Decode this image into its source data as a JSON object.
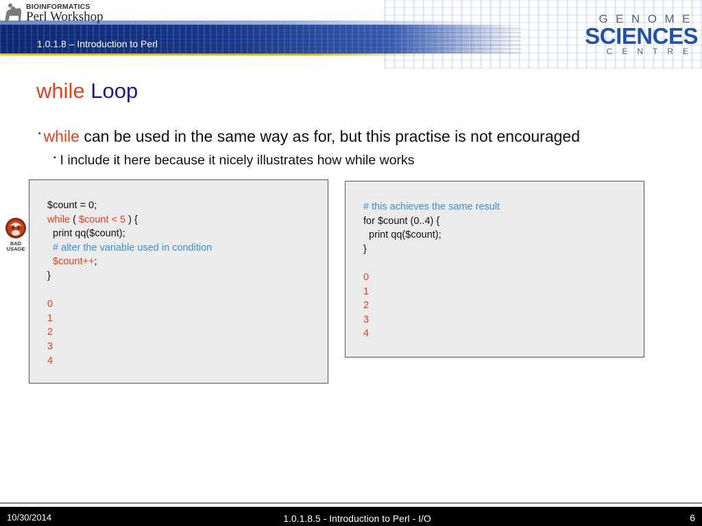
{
  "header": {
    "logo_small": "BIOINFORMATICS",
    "logo_big": "Perl Workshop",
    "course_label": "1.0.1.8 – Introduction to Perl",
    "gsc_top": "GENOME",
    "gsc_mid": "SCIENCES",
    "gsc_bottom": "CENTRE"
  },
  "slide": {
    "title_keyword": "while",
    "title_rest": "Loop",
    "bullet1_keyword": "while",
    "bullet1_rest": "can be used in the same way as for, but this practise is not encouraged",
    "bullet2": "I include it here because it nicely illustrates how while works"
  },
  "badge": {
    "line1": "BAD",
    "line2": "USAGE"
  },
  "code_left": {
    "l1": "$count = 0;",
    "l2_kw": "while",
    "l2_a": " ( ",
    "l2_cond": "$count < 5",
    "l2_b": " ) {",
    "l3": "  print qq($count);",
    "l4": "  # alter the variable used in condition",
    "l5_var": "  $count++",
    "l5_end": ";",
    "l6": "}",
    "out": [
      "0",
      "1",
      "2",
      "3",
      "4"
    ]
  },
  "code_right": {
    "l1": "# this achieves the same result",
    "l2": "for $count (0..4) {",
    "l3": "  print qq($count);",
    "l4": "}",
    "out": [
      "0",
      "1",
      "2",
      "3",
      "4"
    ]
  },
  "footer": {
    "date": "10/30/2014",
    "center": "1.0.1.8.5 - Introduction to Perl - I/O",
    "page": "6"
  },
  "colors": {
    "keyword_red": "#e8401c",
    "title_blue": "#1c1c88",
    "comment_blue": "#3b8fd9",
    "banner_blue": "#1b3c8f",
    "banner_yellow": "#f2c300"
  }
}
